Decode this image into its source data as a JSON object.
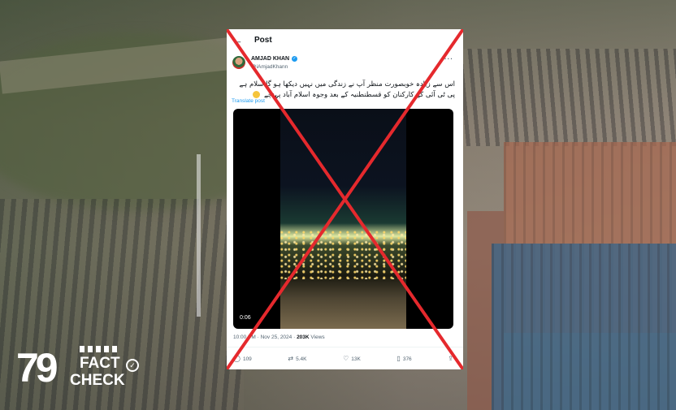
{
  "colors": {
    "cross": "#e5292d",
    "accent": "#1d9bf0",
    "card_bg": "#ffffff"
  },
  "logo": {
    "number": "79",
    "line1": "FACT",
    "line2": "CHECK"
  },
  "post": {
    "back_icon": "arrow-left-icon",
    "header_title": "Post",
    "author_name": "AMJAD KHAN",
    "author_handle": "@iAmjadKhann",
    "more_icon": "more-horizontal-icon",
    "text": "اس سے زیادہ خوبصورت منظر آپ نے زندگی میں نہیں دیکھا ہو گا سلام ہے پی ٹی آئی کے کارکنان کو قسطنطنیہ کے بعد وجوہ اسلام آباد پہنچے",
    "translate_label": "Translate post",
    "video_time": "0:06",
    "time": "10:00 PM",
    "date": "Nov 25, 2024",
    "views_count": "203K",
    "views_label": "Views",
    "replies": "109",
    "reposts": "5.4K",
    "likes": "13K",
    "bookmarks": "376"
  }
}
